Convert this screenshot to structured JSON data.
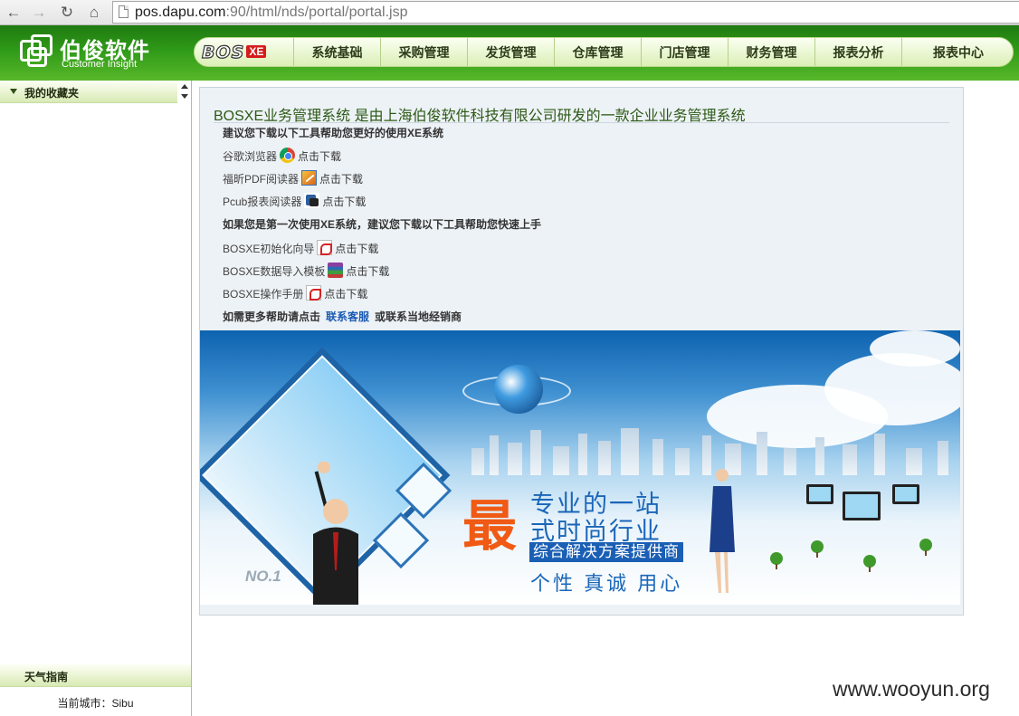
{
  "browser": {
    "url_host": "pos.dapu.com",
    "url_rest": ":90/html/nds/portal/portal.jsp"
  },
  "header": {
    "company_name": "伯俊软件",
    "company_sub": "Customer Insight",
    "product_logo": "BOS",
    "product_badge": "XE",
    "menu": [
      "系统基础",
      "采购管理",
      "发货管理",
      "仓库管理",
      "门店管理",
      "财务管理",
      "报表分析",
      "报表中心"
    ]
  },
  "sidebar": {
    "favorites_label": "我的收藏夹",
    "weather_label": "天气指南",
    "city_text": "当前城市：Sibu"
  },
  "main": {
    "title": "BOSXE业务管理系统 是由上海伯俊软件科技有限公司研发的一款企业业务管理系统",
    "tools_intro": "建议您下载以下工具帮助您更好的使用XE系统",
    "download_text": "点击下载",
    "tools": [
      {
        "name": "谷歌浏览器",
        "icon": "chrome-icon"
      },
      {
        "name": "福昕PDF阅读器",
        "icon": "foxit-pdf-icon"
      },
      {
        "name": "Pcub报表阅读器",
        "icon": "pcub-report-icon"
      }
    ],
    "first_time_intro": "如果您是第一次使用XE系统，建议您下载以下工具帮助您快速上手",
    "guides": [
      {
        "name": "BOSXE初始化向导",
        "icon": "pdf-icon"
      },
      {
        "name": "BOSXE数据导入模板",
        "icon": "archive-icon"
      },
      {
        "name": "BOSXE操作手册",
        "icon": "pdf-icon"
      }
    ],
    "help_prefix": "如需更多帮助请点击",
    "help_link": "联系客服",
    "help_suffix": "或联系当地经销商"
  },
  "banner": {
    "big_char": "最",
    "line1": "专业的一站",
    "line2": "式时尚行业",
    "line3": "综合解决方案提供商",
    "line4": "个性 真诚 用心",
    "badge": "NO.1"
  },
  "watermark": "www.wooyun.org"
}
